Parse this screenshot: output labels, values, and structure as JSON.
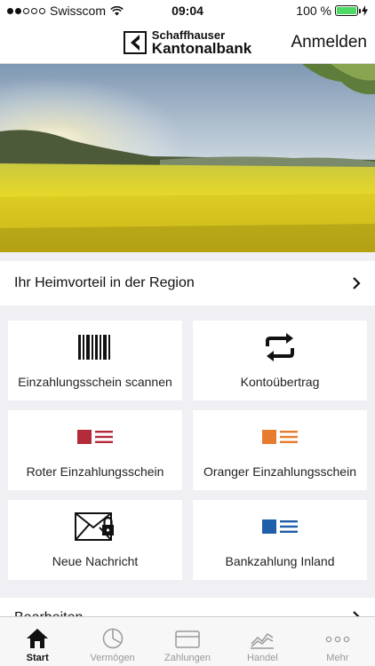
{
  "status_bar": {
    "carrier": "Swisscom",
    "time": "09:04",
    "battery": "100 %"
  },
  "header": {
    "logo_line1": "Schaffhauser",
    "logo_line2": "Kantonalbank",
    "login_label": "Anmelden"
  },
  "region": {
    "label": "Ihr Heimvorteil in der Region"
  },
  "tiles": [
    {
      "label": "Einzahlungsschein scannen",
      "icon": "barcode-icon"
    },
    {
      "label": "Kontoübertrag",
      "icon": "transfer-icon"
    },
    {
      "label": "Roter Einzahlungsschein",
      "icon": "red-slip-icon",
      "color": "#b32a3a"
    },
    {
      "label": "Oranger Einzahlungsschein",
      "icon": "orange-slip-icon",
      "color": "#e87c2e"
    },
    {
      "label": "Neue Nachricht",
      "icon": "secure-mail-icon"
    },
    {
      "label": "Bankzahlung Inland",
      "icon": "bank-payment-icon",
      "color": "#1f5ea8"
    }
  ],
  "edit_row": {
    "label": "Bearbeiten"
  },
  "tab_bar": {
    "tabs": [
      {
        "label": "Start",
        "icon": "home-icon",
        "active": true
      },
      {
        "label": "Vermögen",
        "icon": "pie-chart-icon",
        "active": false
      },
      {
        "label": "Zahlungen",
        "icon": "card-icon",
        "active": false
      },
      {
        "label": "Handel",
        "icon": "trend-chart-icon",
        "active": false
      },
      {
        "label": "Mehr",
        "icon": "more-icon",
        "active": false
      }
    ]
  }
}
